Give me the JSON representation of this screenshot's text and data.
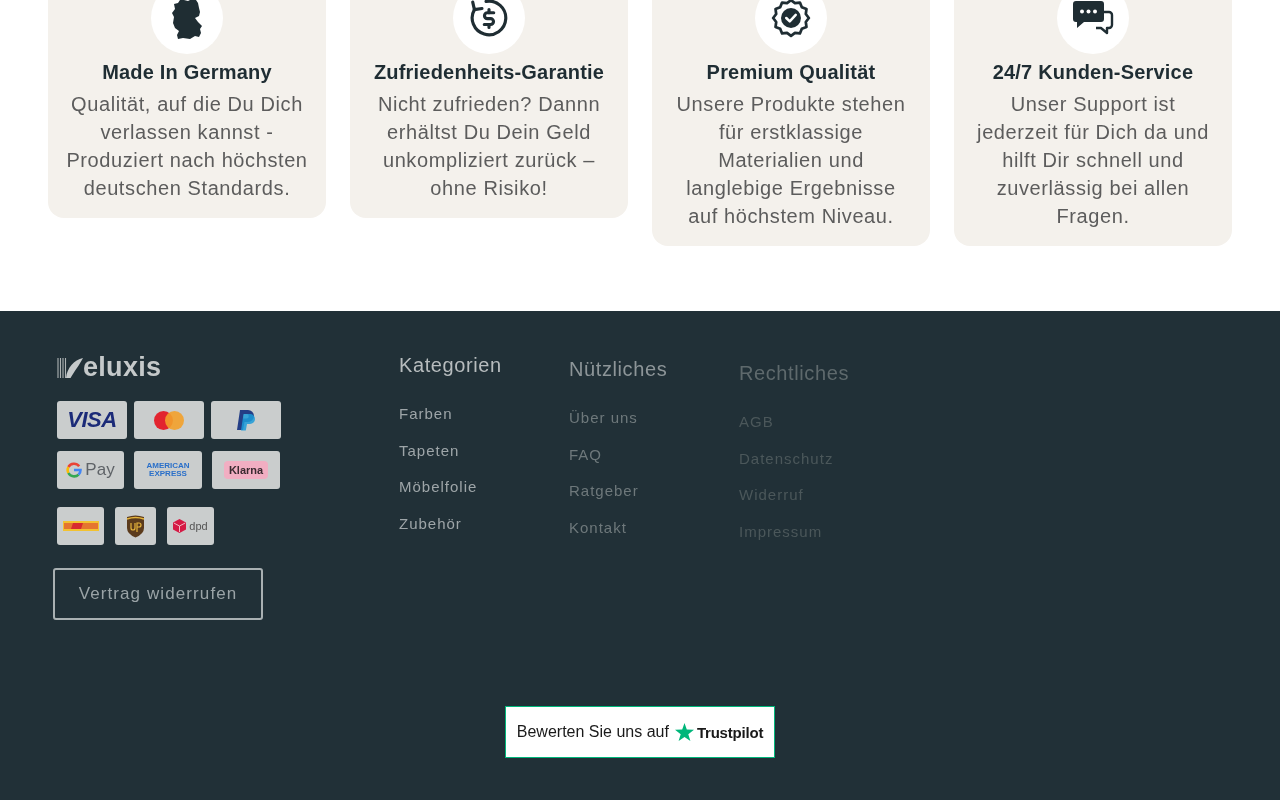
{
  "features": [
    {
      "kind": "map",
      "title": "Made In Germany",
      "text": "Qualität, auf die Du Dich verlassen kannst - Produziert nach höchsten deutschen Standards."
    },
    {
      "kind": "refund",
      "title": "Zufriedenheits-Garantie",
      "text": "Nicht zufrieden? Dannn erhältst Du Dein Geld unkompliziert zurück – ohne Risiko!"
    },
    {
      "kind": "quality",
      "title": "Premium Qualität",
      "text": "Unsere Produkte stehen für erstklassige Materialien und langlebige Ergebnisse auf höchstem Niveau."
    },
    {
      "kind": "support",
      "title": "24/7 Kunden-Service",
      "text": "Unser Support ist jederzeit für Dich da und hilft Dir schnell und zuverlässig bei allen Fragen."
    }
  ],
  "footer": {
    "logo": "eluxis",
    "payment_methods": [
      {
        "kind": "visa",
        "label": "VISA"
      },
      {
        "kind": "mastercard"
      },
      {
        "kind": "paypal"
      },
      {
        "kind": "gpay",
        "label": "Pay"
      },
      {
        "kind": "amex",
        "label": "AMERICAN EXPRESS"
      },
      {
        "kind": "klarna",
        "label": "Klarna"
      }
    ],
    "shipping_methods": [
      {
        "kind": "dhl"
      },
      {
        "kind": "ups"
      },
      {
        "kind": "dpd",
        "label": "dpd"
      }
    ],
    "revoke_button": "Vertrag widerrufen",
    "columns": [
      {
        "heading": "Kategorien",
        "links": [
          "Farben",
          "Tapeten",
          "Möbelfolie",
          "Zubehör"
        ]
      },
      {
        "heading": "Nützliches",
        "links": [
          "Über uns",
          "FAQ",
          "Ratgeber",
          "Kontakt"
        ]
      },
      {
        "heading": "Rechtliches",
        "links": [
          "AGB",
          "Datenschutz",
          "Widerruf",
          "Impressum"
        ]
      }
    ],
    "review_badge": {
      "text": "Bewerten Sie uns auf",
      "brand": "Trustpilot"
    }
  }
}
